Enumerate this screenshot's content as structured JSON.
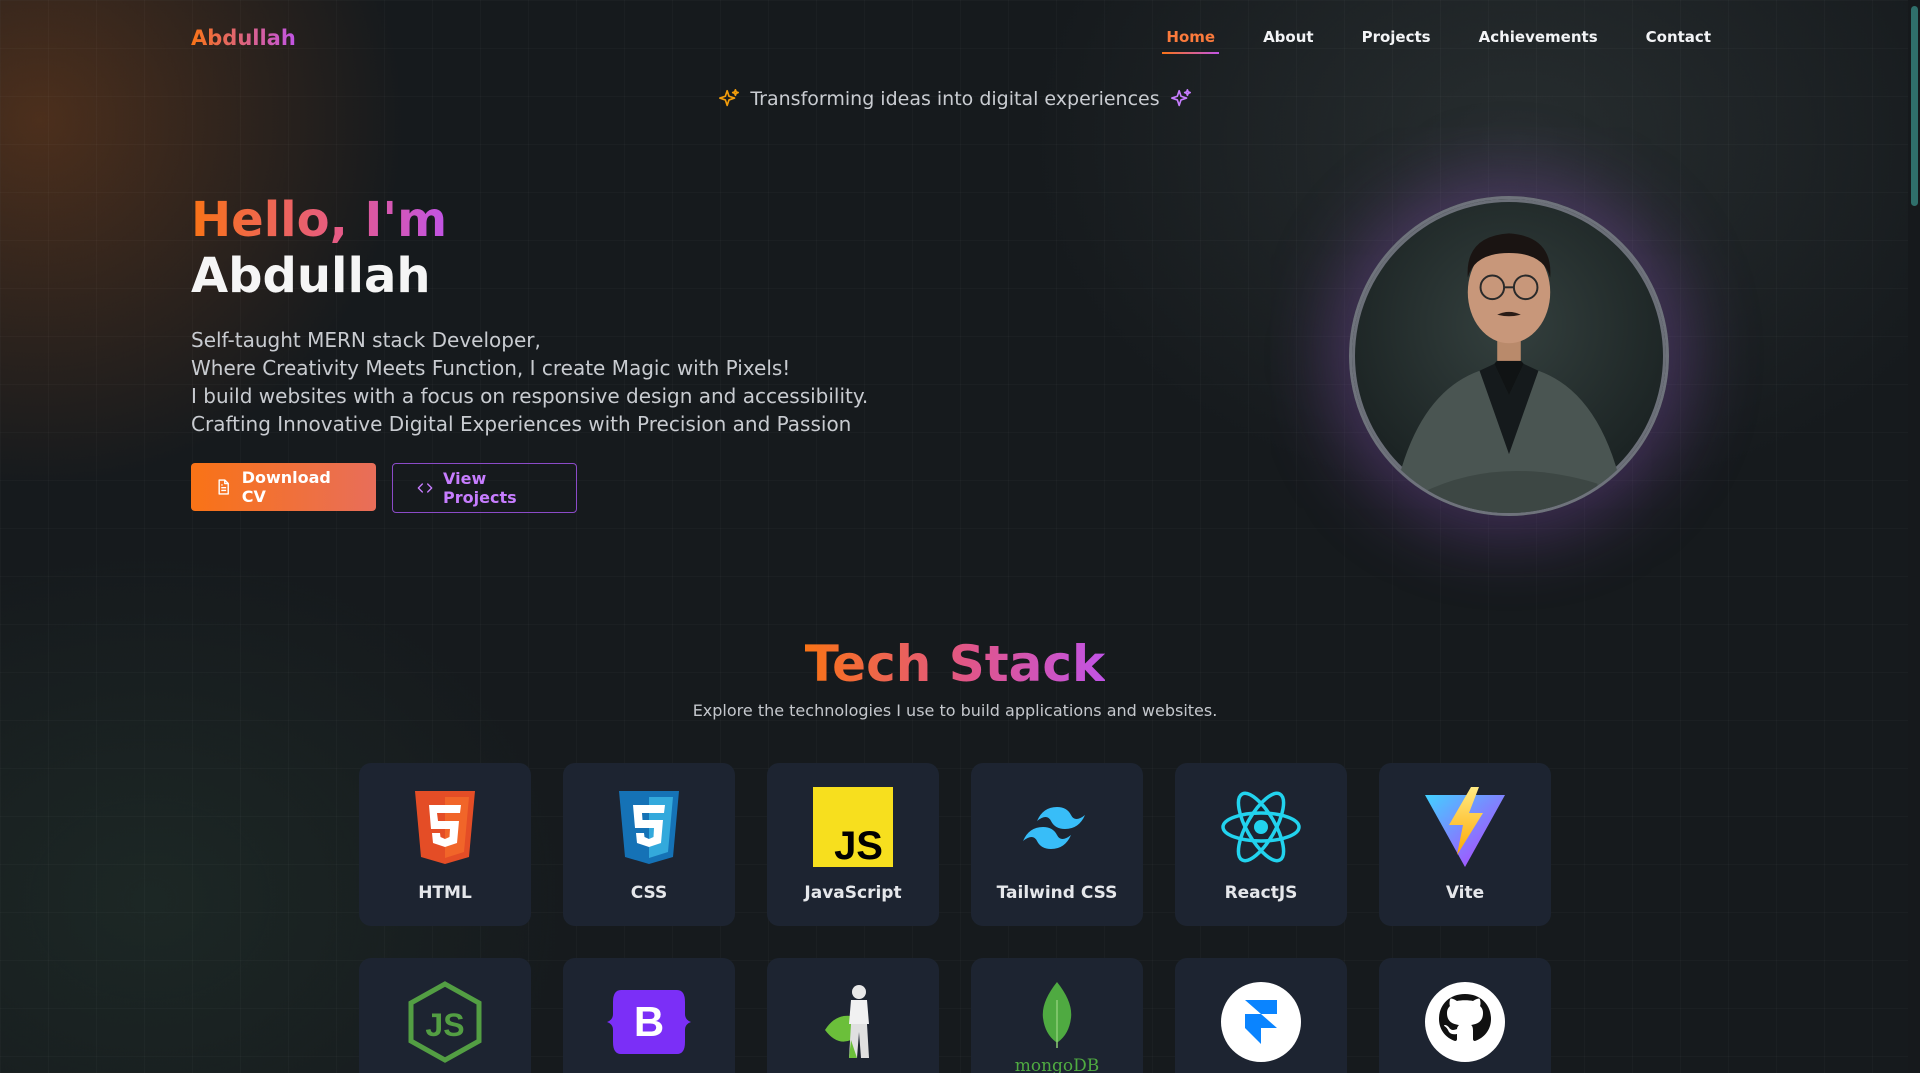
{
  "nav": {
    "logo": "Abdullah",
    "links": [
      {
        "label": "Home",
        "active": true
      },
      {
        "label": "About",
        "active": false
      },
      {
        "label": "Projects",
        "active": false
      },
      {
        "label": "Achievements",
        "active": false
      },
      {
        "label": "Contact",
        "active": false
      }
    ]
  },
  "tagline": "Transforming ideas into digital experiences",
  "hero": {
    "greeting": "Hello, I'm",
    "name": "Abdullah",
    "lines": [
      "Self-taught MERN stack Developer,",
      "Where Creativity Meets Function, I create Magic with Pixels!",
      "I build websites with a focus on responsive design and accessibility.",
      "Crafting Innovative Digital Experiences with Precision and Passion"
    ],
    "download_cv": "Download CV",
    "view_projects": "View Projects"
  },
  "tech": {
    "title": "Tech Stack",
    "subtitle": "Explore the technologies I use to build applications and websites.",
    "items": [
      {
        "label": "HTML",
        "icon": "html5-icon"
      },
      {
        "label": "CSS",
        "icon": "css3-icon"
      },
      {
        "label": "JavaScript",
        "icon": "javascript-icon"
      },
      {
        "label": "Tailwind CSS",
        "icon": "tailwind-icon"
      },
      {
        "label": "ReactJS",
        "icon": "react-icon"
      },
      {
        "label": "Vite",
        "icon": "vite-icon"
      },
      {
        "label": "",
        "icon": "nodejs-icon"
      },
      {
        "label": "",
        "icon": "bootstrap-icon"
      },
      {
        "label": "",
        "icon": "mongoose-mascot-icon"
      },
      {
        "label": "mongoDB",
        "icon": "mongodb-icon"
      },
      {
        "label": "",
        "icon": "framer-icon"
      },
      {
        "label": "",
        "icon": "github-icon"
      }
    ]
  },
  "colors": {
    "accent_orange": "#f97316",
    "accent_purple": "#c154e6",
    "background": "#161a1d",
    "card": "#1d2431"
  }
}
